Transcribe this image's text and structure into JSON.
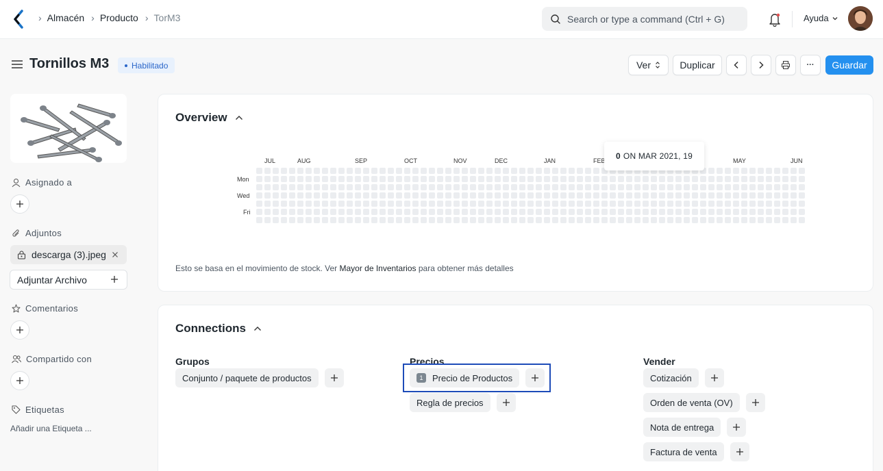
{
  "breadcrumbs": [
    "Almacén",
    "Producto",
    "TorM3"
  ],
  "search": {
    "placeholder": "Search or type a command (Ctrl + G)"
  },
  "help_label": "Ayuda",
  "page": {
    "title": "Tornillos M3",
    "status": "Habilitado"
  },
  "actions": {
    "view": "Ver",
    "duplicate": "Duplicar",
    "more": "···",
    "save": "Guardar"
  },
  "sidebar": {
    "assigned_to": "Asignado a",
    "attachments": "Adjuntos",
    "attachment_file": "descarga (3).jpeg",
    "attach_file": "Adjuntar Archivo",
    "comments": "Comentarios",
    "shared_with": "Compartido con",
    "tags": "Etiquetas",
    "add_tag": "Añadir una Etiqueta ..."
  },
  "overview": {
    "title": "Overview",
    "months": [
      "JUL",
      "AUG",
      "SEP",
      "OCT",
      "NOV",
      "DEC",
      "JAN",
      "FEB",
      "MAY",
      "JUN"
    ],
    "days": [
      "Mon",
      "Wed",
      "Fri"
    ],
    "tooltip_count": "0",
    "tooltip_text": "ON MAR 2021, 19",
    "note_prefix": "Esto se basa en el movimiento de stock. Ver ",
    "note_link": "Mayor de Inventarios",
    "note_suffix": " para obtener más detalles"
  },
  "connections": {
    "title": "Connections",
    "groups": {
      "heading": "Grupos",
      "items": [
        {
          "label": "Conjunto / paquete de productos"
        }
      ]
    },
    "prices": {
      "heading": "Precios",
      "items": [
        {
          "label": "Precio de Productos",
          "count": "1"
        },
        {
          "label": "Regla de precios"
        }
      ]
    },
    "sell": {
      "heading": "Vender",
      "items": [
        {
          "label": "Cotización"
        },
        {
          "label": "Orden de venta (OV)"
        },
        {
          "label": "Nota de entrega"
        },
        {
          "label": "Factura de venta"
        }
      ]
    }
  },
  "colors": {
    "primary": "#2490ef",
    "badge_bg": "#e8f1fd",
    "badge_text": "#2a66c9",
    "highlight": "#1d4bb8",
    "heatmap_empty": "#ebedf0"
  }
}
